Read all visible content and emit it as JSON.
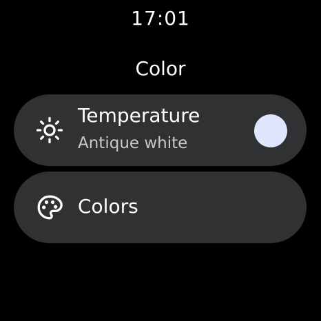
{
  "status": {
    "time": "17:01"
  },
  "screen": {
    "title": "Color"
  },
  "items": [
    {
      "label": "Temperature",
      "value": "Antique white",
      "icon": "brightness-icon",
      "swatch_color": "#e1e6ff"
    },
    {
      "label": "Colors",
      "icon": "palette-icon"
    }
  ],
  "colors": {
    "background": "#000000",
    "chip": "#303133",
    "text": "#ffffff",
    "secondary_text": "#c8c9cc"
  }
}
